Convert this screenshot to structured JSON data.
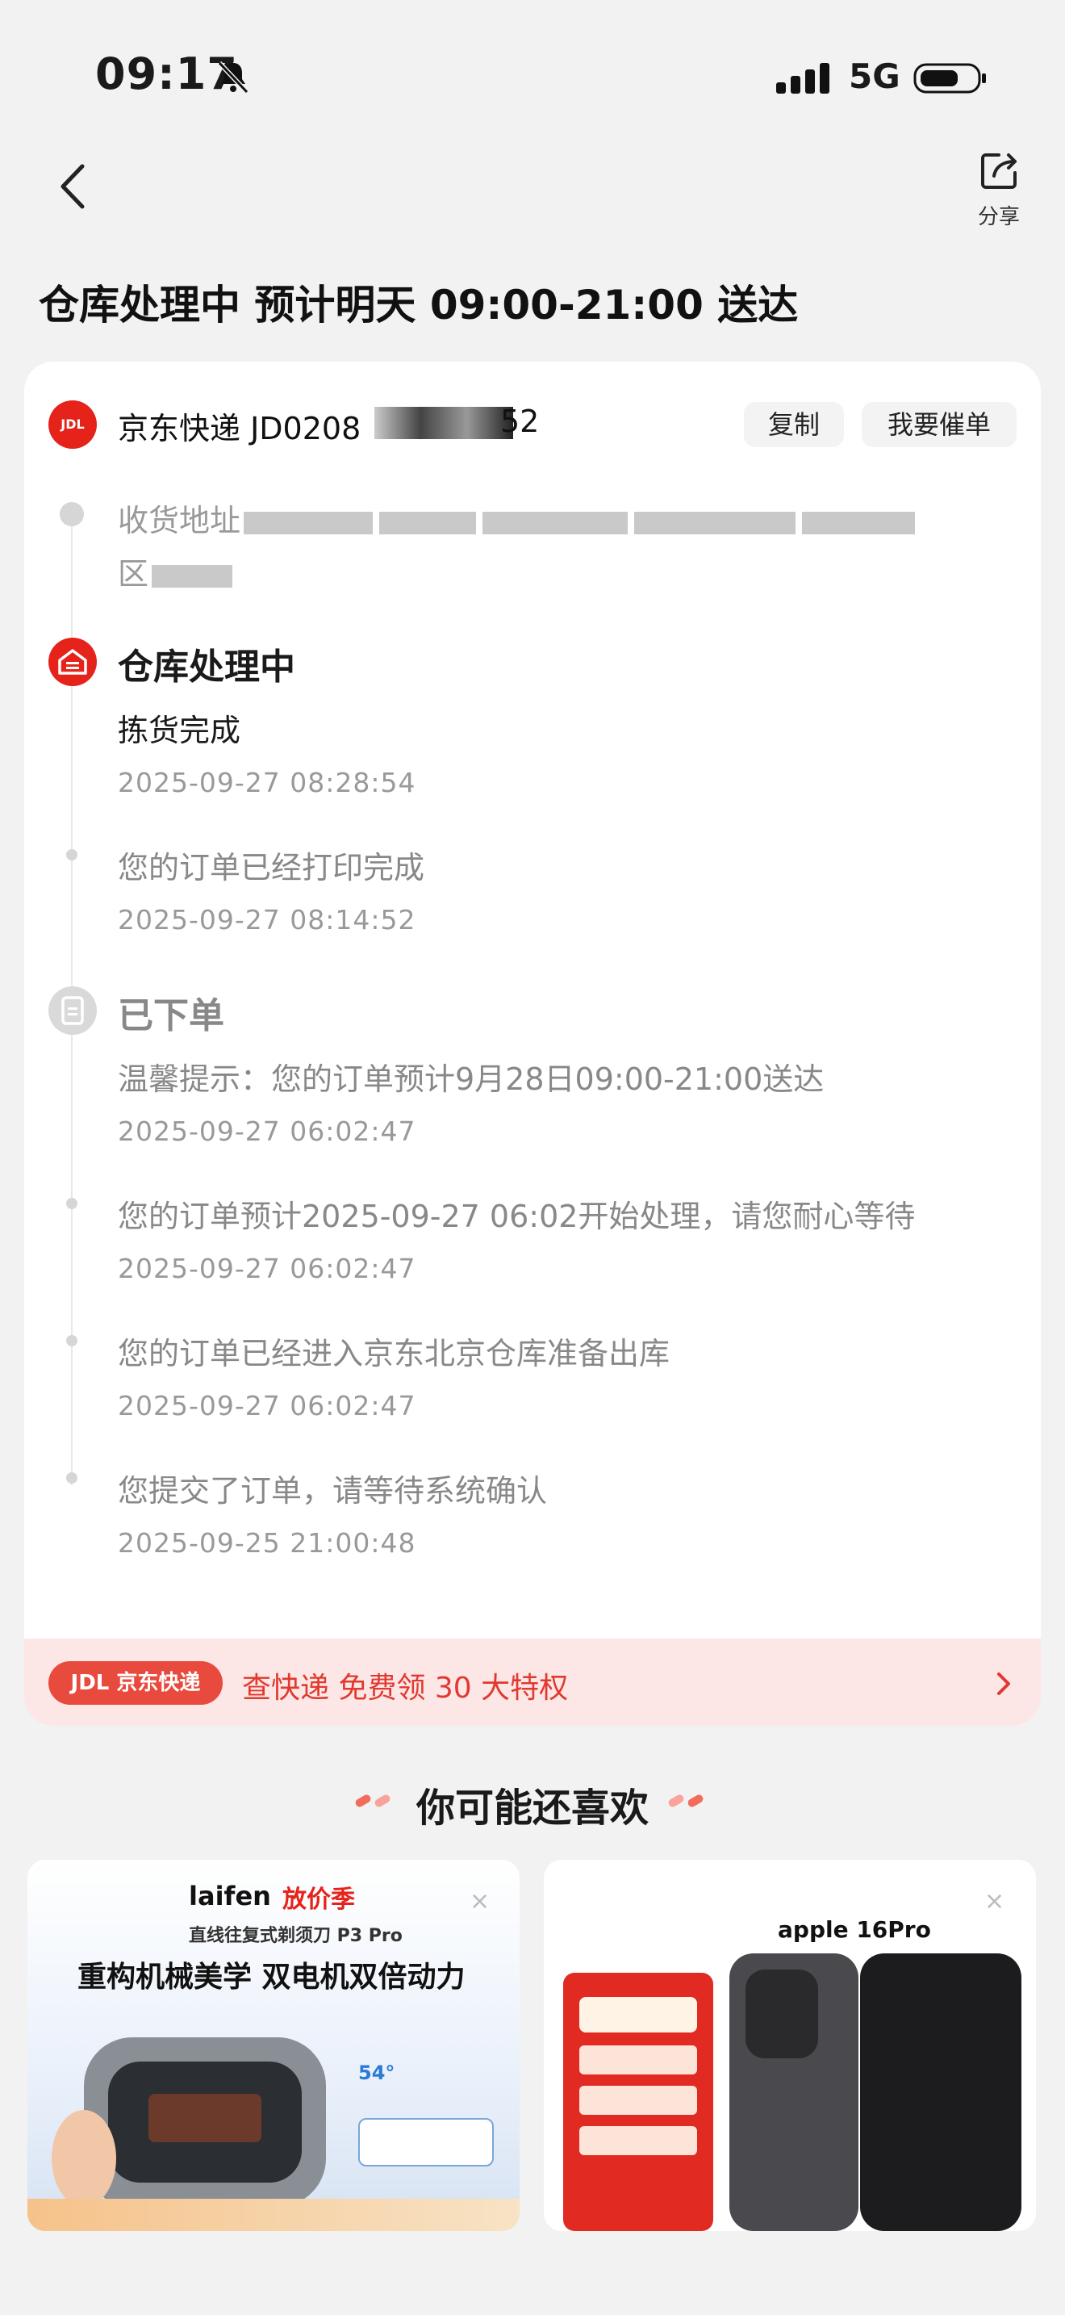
{
  "status_bar": {
    "time": "09:17",
    "network": "5G"
  },
  "nav": {
    "share_label": "分享"
  },
  "headline": "仓库处理中 预计明天 09:00-21:00 送达",
  "card": {
    "courier_prefix": "京东快递 JD0208",
    "courier_suffix": "52",
    "logo_text": "JDL",
    "copy_button": "复制",
    "urge_button": "我要催单",
    "address_lead": "收货地址",
    "address_tail": "区",
    "stages": [
      {
        "title": "仓库处理中",
        "events": [
          {
            "text": "拣货完成",
            "time": "2025-09-27 08:28:54"
          },
          {
            "text": "您的订单已经打印完成",
            "time": "2025-09-27 08:14:52"
          }
        ]
      },
      {
        "title": "已下单",
        "events": [
          {
            "text": "温馨提示：您的订单预计9月28日09:00-21:00送达",
            "time": "2025-09-27 06:02:47"
          },
          {
            "text": "您的订单预计2025-09-27 06:02开始处理，请您耐心等待",
            "time": "2025-09-27 06:02:47"
          },
          {
            "text": "您的订单已经进入京东北京仓库准备出库",
            "time": "2025-09-27 06:02:47"
          },
          {
            "text": "您提交了订单，请等待系统确认",
            "time": "2025-09-25 21:00:48"
          }
        ]
      }
    ]
  },
  "promo": {
    "badge": "JDL 京东快递",
    "text": "查快递 免费领 30 大特权"
  },
  "recommend": {
    "title": "你可能还喜欢",
    "products": [
      {
        "brand": "laifen",
        "tag": "放价季",
        "subtitle": "直线往复式剃须刀 P3 Pro",
        "headline": "重构机械美学 双电机双倍动力"
      },
      {
        "name": "apple 16Pro"
      }
    ]
  },
  "colors": {
    "brand_red": "#e6231b",
    "promo_bg": "#fde6e6"
  }
}
